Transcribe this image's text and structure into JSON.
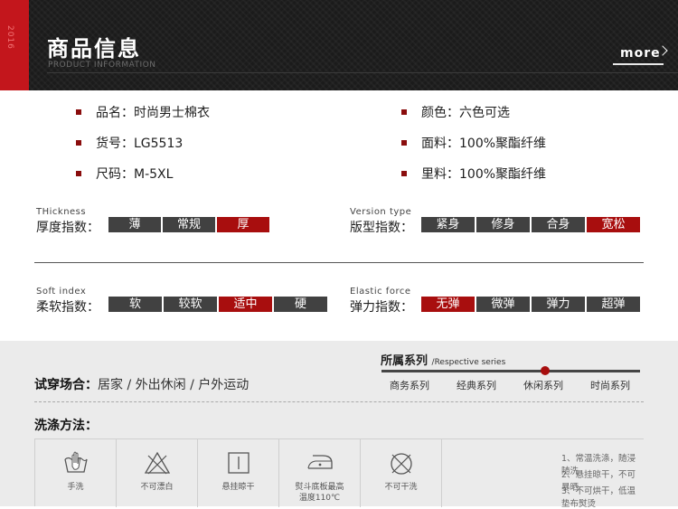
{
  "header": {
    "title": "商品信息",
    "subtitle": "PRODUCT INFORMATION",
    "more": "more",
    "side_text": "2016"
  },
  "info": {
    "name": "品名：时尚男士棉衣",
    "code": "货号：LG5513",
    "size": "尺码：M-5XL",
    "color": "颜色：六色可选",
    "fabric": "面料：100%聚酯纤维",
    "lining": "里料：100%聚酯纤维"
  },
  "scales": {
    "thickness": {
      "en": "THickness",
      "zh": "厚度指数：",
      "options": [
        "薄",
        "常规",
        "厚"
      ],
      "active": 2
    },
    "version": {
      "en": "Version type",
      "zh": "版型指数：",
      "options": [
        "紧身",
        "修身",
        "合身",
        "宽松"
      ],
      "active": 3
    },
    "soft": {
      "en": "Soft index",
      "zh": "柔软指数：",
      "options": [
        "软",
        "较软",
        "适中",
        "硬"
      ],
      "active": 2
    },
    "elastic": {
      "en": "Elastic force",
      "zh": "弹力指数：",
      "options": [
        "无弹",
        "微弹",
        "弹力",
        "超弹"
      ],
      "active": 0
    }
  },
  "series": {
    "title": "所属系列",
    "subtitle": "/Respective series",
    "items": [
      "商务系列",
      "经典系列",
      "休闲系列",
      "时尚系列"
    ],
    "active": 2
  },
  "occasion": {
    "label": "试穿场合：",
    "value": "居家 / 外出休闲 / 户外运动"
  },
  "wash": {
    "title": "洗涤方法：",
    "items": [
      {
        "icon": "hand-wash-icon",
        "label": "手洗"
      },
      {
        "icon": "no-bleach-icon",
        "label": "不可漂白"
      },
      {
        "icon": "hang-dry-icon",
        "label": "悬挂晾干"
      },
      {
        "icon": "iron-icon",
        "label": "熨斗底板最高\n温度110℃"
      },
      {
        "icon": "no-tumble-dry-icon",
        "label": "不可干洗"
      }
    ],
    "notes": [
      "1、常温洗涤，随浸随洗",
      "2、悬挂晾干，不可暴晒",
      "3、不可烘干，低温垫布熨烫"
    ]
  },
  "colors": {
    "accent": "#a80e0e",
    "segment": "#414141",
    "header_red": "#c3161c"
  }
}
